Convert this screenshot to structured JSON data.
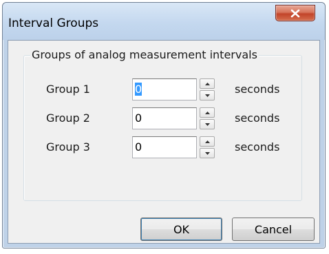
{
  "window": {
    "title": "Interval Groups"
  },
  "groupbox": {
    "label": "Groups of analog measurement intervals"
  },
  "rows": [
    {
      "label": "Group 1",
      "value": "0",
      "unit": "seconds",
      "selected": true
    },
    {
      "label": "Group 2",
      "value": "0",
      "unit": "seconds",
      "selected": false
    },
    {
      "label": "Group 3",
      "value": "0",
      "unit": "seconds",
      "selected": false
    }
  ],
  "buttons": {
    "ok_label": "OK",
    "cancel_label": "Cancel"
  },
  "icons": {
    "close": "close-icon",
    "spin_up": "spin-up-arrow-icon",
    "spin_down": "spin-down-arrow-icon"
  },
  "colors": {
    "close_button": "#c7472d",
    "selection": "#3399ff",
    "dialog_bg": "#f0f0f0",
    "frame": "#bfd2e8"
  }
}
